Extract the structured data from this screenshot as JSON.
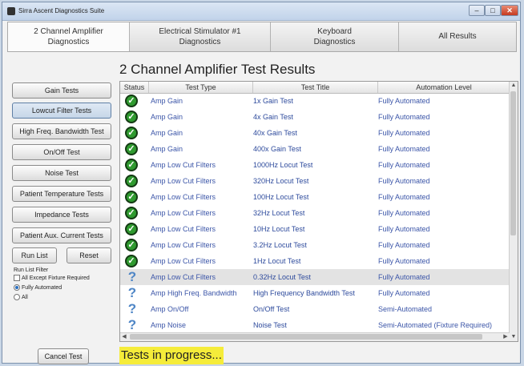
{
  "window": {
    "title": "Sirra Ascent Diagnostics Suite",
    "minimize": "–",
    "maximize": "□",
    "close": "✕"
  },
  "tabs": [
    {
      "label": "2 Channel Amplifier\nDiagnostics",
      "active": true
    },
    {
      "label": "Electrical Stimulator #1\nDiagnostics",
      "active": false
    },
    {
      "label": "Keyboard\nDiagnostics",
      "active": false
    },
    {
      "label": "All Results",
      "active": false
    }
  ],
  "main": {
    "title": "2 Channel Amplifier Test Results",
    "progress": "Tests in progress..."
  },
  "sidebar": {
    "buttons": [
      "Gain Tests",
      "Lowcut Filter Tests",
      "High Freq. Bandwidth Test",
      "On/Off Test",
      "Noise Test",
      "Patient Temperature Tests",
      "Impedance Tests",
      "Patient Aux. Current Tests"
    ],
    "run_list": "Run List",
    "reset": "Reset",
    "filter_label": "Run List Filter",
    "filter_options": [
      "All Except Fixture Required",
      "Fully Automated",
      "All"
    ],
    "cancel": "Cancel Test"
  },
  "table": {
    "headers": [
      "Status",
      "Test Type",
      "Test Title",
      "Automation Level"
    ],
    "rows": [
      {
        "status": "passed",
        "type": "Amp Gain",
        "title": "1x Gain Test",
        "level": "Fully Automated"
      },
      {
        "status": "passed",
        "type": "Amp Gain",
        "title": "4x Gain Test",
        "level": "Fully Automated"
      },
      {
        "status": "passed",
        "type": "Amp Gain",
        "title": "40x Gain Test",
        "level": "Fully Automated"
      },
      {
        "status": "passed",
        "type": "Amp Gain",
        "title": "400x Gain Test",
        "level": "Fully Automated"
      },
      {
        "status": "passed",
        "type": "Amp Low Cut Filters",
        "title": "1000Hz Locut Test",
        "level": "Fully Automated"
      },
      {
        "status": "passed",
        "type": "Amp Low Cut Filters",
        "title": "320Hz Locut Test",
        "level": "Fully Automated"
      },
      {
        "status": "passed",
        "type": "Amp Low Cut Filters",
        "title": "100Hz Locut Test",
        "level": "Fully Automated"
      },
      {
        "status": "passed",
        "type": "Amp Low Cut Filters",
        "title": "32Hz Locut Test",
        "level": "Fully Automated"
      },
      {
        "status": "passed",
        "type": "Amp Low Cut Filters",
        "title": "10Hz Locut Test",
        "level": "Fully Automated"
      },
      {
        "status": "passed",
        "type": "Amp Low Cut Filters",
        "title": "3.2Hz Locut Test",
        "level": "Fully Automated"
      },
      {
        "status": "passed",
        "type": "Amp Low Cut Filters",
        "title": "1Hz Locut Test",
        "level": "Fully Automated"
      },
      {
        "status": "pending",
        "type": "Amp Low Cut Filters",
        "title": "0.32Hz Locut Test",
        "level": "Fully Automated"
      },
      {
        "status": "pending",
        "type": "Amp High Freq. Bandwidth",
        "title": "High Frequency Bandwidth Test",
        "level": "Fully Automated"
      },
      {
        "status": "pending",
        "type": "Amp On/Off",
        "title": "On/Off Test",
        "level": "Semi-Automated"
      },
      {
        "status": "pending",
        "type": "Amp Noise",
        "title": "Noise Test",
        "level": "Semi-Automated (Fixture Required)"
      }
    ]
  },
  "icons": {
    "passed": "check-circle-icon",
    "pending": "question-mark-icon"
  },
  "colors": {
    "passed": "#2f9a2f",
    "pending": "#4f86c6",
    "highlight": "#f5ec3a",
    "link_text": "#3b55a8"
  }
}
